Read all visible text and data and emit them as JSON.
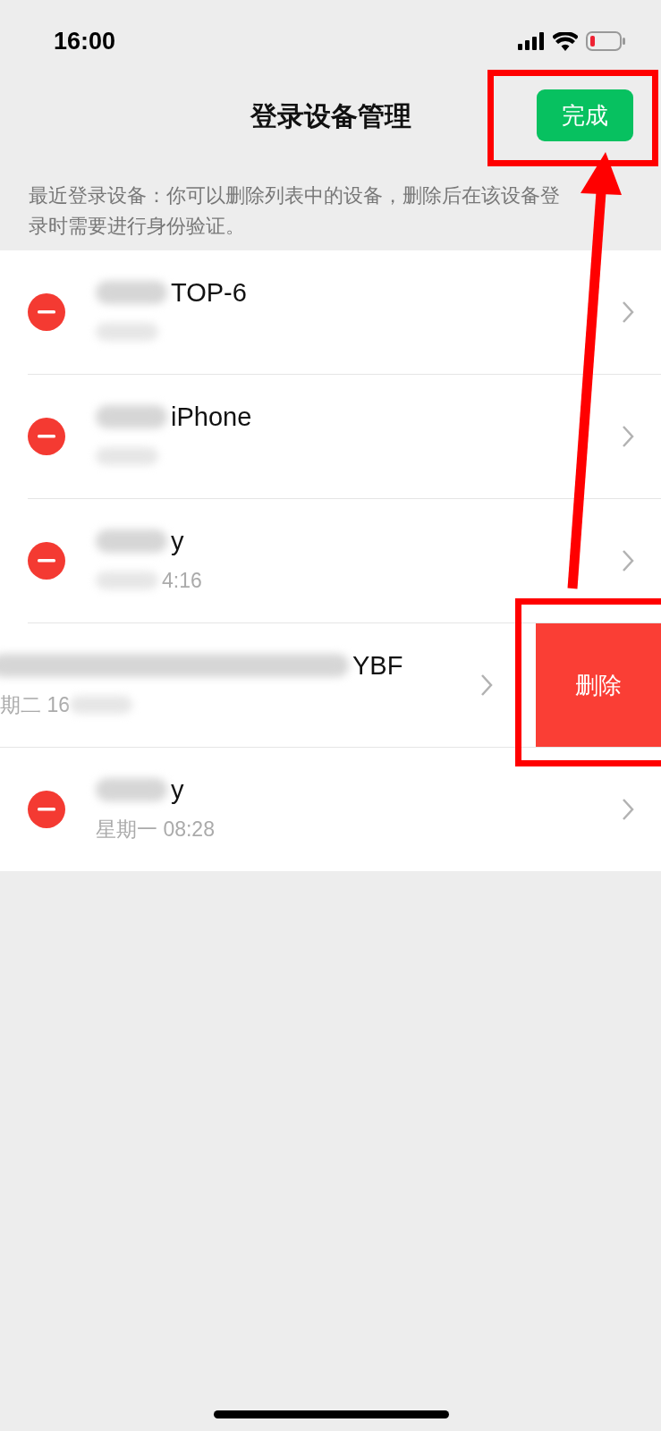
{
  "status_bar": {
    "time": "16:00"
  },
  "nav": {
    "title": "登录设备管理",
    "done_button": "完成"
  },
  "description": "最近登录设备：你可以删除列表中的设备，删除后在该设备登录时需要进行身份验证。",
  "devices": [
    {
      "name": "TOP-6",
      "time_redacted": true,
      "swiped": false
    },
    {
      "name": "iPhone",
      "time_redacted": true,
      "swiped": false
    },
    {
      "name": "y",
      "time": "4:16",
      "time_redacted": true,
      "swiped": false
    },
    {
      "name": "YBF",
      "time": "期二 16",
      "time_redacted": true,
      "swiped": true
    },
    {
      "name": "y",
      "time": "星期一 08:28",
      "time_redacted": false,
      "swiped": false
    }
  ],
  "delete_button": "删除"
}
